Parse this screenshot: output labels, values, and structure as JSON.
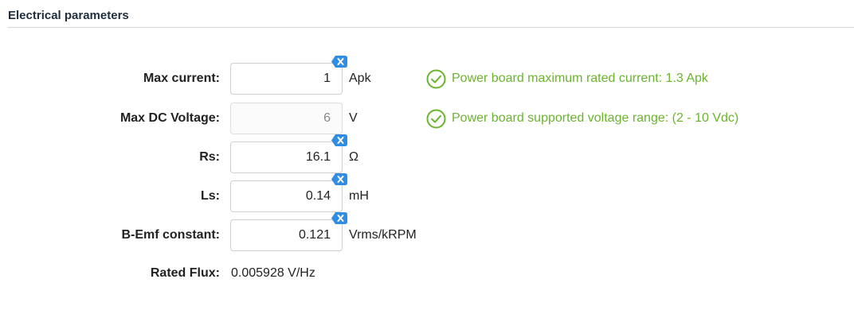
{
  "section": {
    "title": "Electrical parameters"
  },
  "colors": {
    "accent_clear": "#2f8de4",
    "status_ok": "#6ab42d",
    "title": "#1f2d3d"
  },
  "fields": {
    "max_current": {
      "label": "Max current:",
      "value": "1",
      "unit": "Apk",
      "clearable": true,
      "clear_icon": "clear-x-icon"
    },
    "max_dc_voltage": {
      "label": "Max DC Voltage:",
      "value": "6",
      "unit": "V",
      "disabled": true
    },
    "rs": {
      "label": "Rs:",
      "value": "16.1",
      "unit": "Ω",
      "clearable": true,
      "clear_icon": "clear-x-icon"
    },
    "ls": {
      "label": "Ls:",
      "value": "0.14",
      "unit": "mH",
      "clearable": true,
      "clear_icon": "clear-x-icon"
    },
    "bemf": {
      "label": "B-Emf constant:",
      "value": "0.121",
      "unit": "Vrms/kRPM",
      "clearable": true,
      "clear_icon": "clear-x-icon"
    },
    "rated_flux": {
      "label": "Rated Flux:",
      "value": "0.005928 V/Hz"
    }
  },
  "status": {
    "current": {
      "text": "Power board maximum rated current: 1.3 Apk",
      "icon": "check-circle-icon"
    },
    "voltage": {
      "text": "Power board supported voltage range: (2 - 10 Vdc)",
      "icon": "check-circle-icon"
    }
  }
}
